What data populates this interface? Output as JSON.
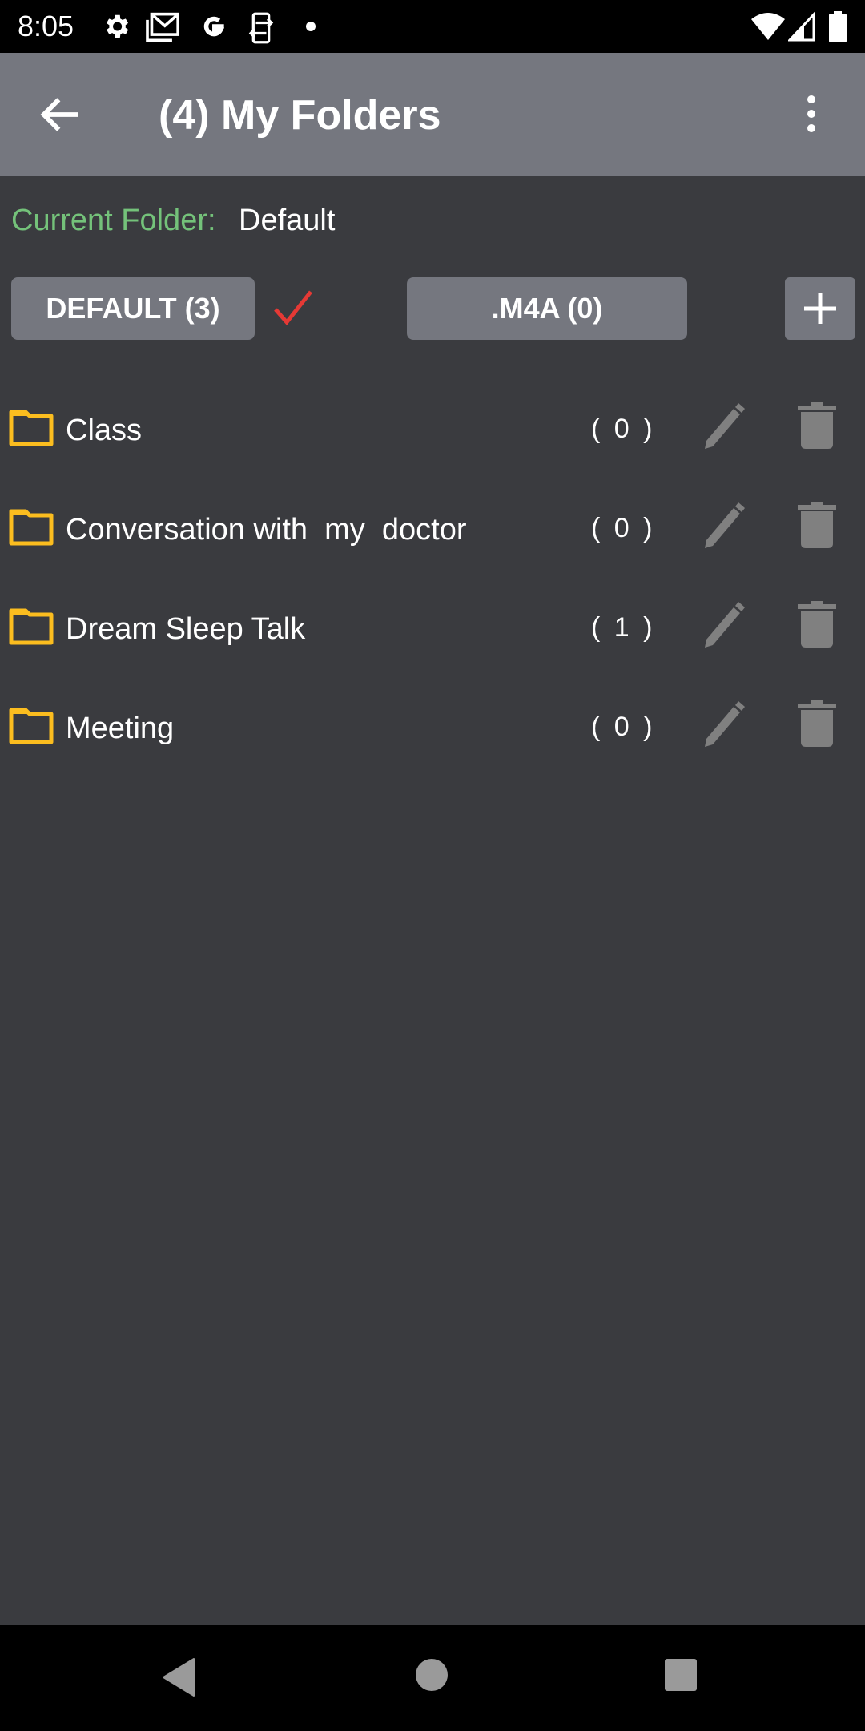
{
  "status_bar": {
    "time": "8:05",
    "icons": [
      "settings-icon",
      "gmail-icon",
      "google-icon",
      "phone-sync-icon",
      "dot-icon",
      "wifi-icon",
      "signal-icon",
      "battery-icon"
    ]
  },
  "app_bar": {
    "title": "(4) My Folders",
    "back_icon": "arrow-back-icon",
    "menu_icon": "more-vert-icon"
  },
  "current_folder": {
    "label": "Current Folder:",
    "value": "Default"
  },
  "folder_buttons": [
    {
      "label": "DEFAULT (3)",
      "selected": true
    },
    {
      "label": ".M4A (0)",
      "selected": false
    }
  ],
  "add_button_icon": "plus-icon",
  "folders": [
    {
      "name": "Class",
      "count": "( 0 )"
    },
    {
      "name": "Conversation with  my  doctor",
      "count": "( 0 )"
    },
    {
      "name": "Dream Sleep Talk",
      "count": "( 1 )"
    },
    {
      "name": "Meeting",
      "count": "( 0 )"
    }
  ],
  "colors": {
    "accent_green": "#74c27a",
    "check_red": "#e53935",
    "folder_yellow": "#fbbd1f",
    "app_bar": "#75777f",
    "background": "#3a3b3f",
    "icon_grey": "#808080"
  },
  "nav_bar": {
    "buttons": [
      "back-icon",
      "home-icon",
      "recents-icon"
    ]
  }
}
